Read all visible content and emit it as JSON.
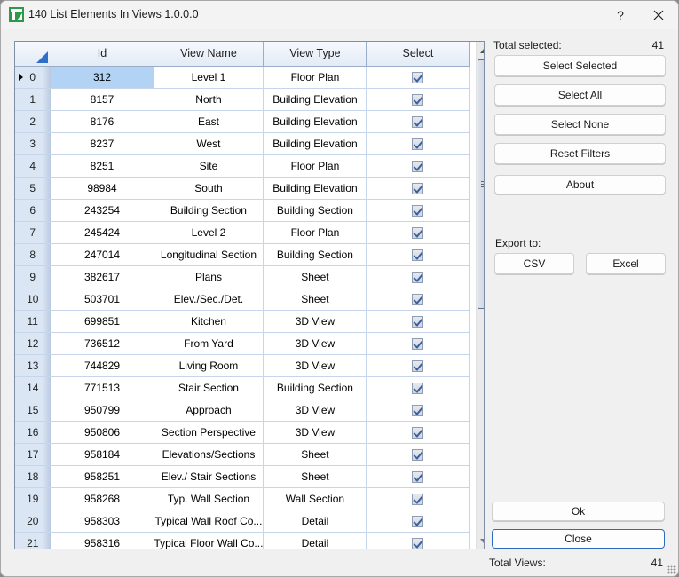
{
  "window": {
    "title": "140 List Elements In Views 1.0.0.0",
    "icon": "app-logo-icon",
    "help_label": "?",
    "close_icon": "close-icon"
  },
  "grid": {
    "columns": [
      "Id",
      "View Name",
      "View Type",
      "Select"
    ],
    "current_row": 0,
    "rows": [
      {
        "index": "0",
        "id": "312",
        "name": "Level 1",
        "type": "Floor Plan",
        "selected": true
      },
      {
        "index": "1",
        "id": "8157",
        "name": "North",
        "type": "Building Elevation",
        "selected": true
      },
      {
        "index": "2",
        "id": "8176",
        "name": "East",
        "type": "Building Elevation",
        "selected": true
      },
      {
        "index": "3",
        "id": "8237",
        "name": "West",
        "type": "Building Elevation",
        "selected": true
      },
      {
        "index": "4",
        "id": "8251",
        "name": "Site",
        "type": "Floor Plan",
        "selected": true
      },
      {
        "index": "5",
        "id": "98984",
        "name": "South",
        "type": "Building Elevation",
        "selected": true
      },
      {
        "index": "6",
        "id": "243254",
        "name": "Building Section",
        "type": "Building Section",
        "selected": true
      },
      {
        "index": "7",
        "id": "245424",
        "name": "Level 2",
        "type": "Floor Plan",
        "selected": true
      },
      {
        "index": "8",
        "id": "247014",
        "name": "Longitudinal Section",
        "type": "Building Section",
        "selected": true
      },
      {
        "index": "9",
        "id": "382617",
        "name": "Plans",
        "type": "Sheet",
        "selected": true
      },
      {
        "index": "10",
        "id": "503701",
        "name": "Elev./Sec./Det.",
        "type": "Sheet",
        "selected": true
      },
      {
        "index": "11",
        "id": "699851",
        "name": "Kitchen",
        "type": "3D View",
        "selected": true
      },
      {
        "index": "12",
        "id": "736512",
        "name": "From Yard",
        "type": "3D View",
        "selected": true
      },
      {
        "index": "13",
        "id": "744829",
        "name": "Living Room",
        "type": "3D View",
        "selected": true
      },
      {
        "index": "14",
        "id": "771513",
        "name": "Stair Section",
        "type": "Building Section",
        "selected": true
      },
      {
        "index": "15",
        "id": "950799",
        "name": "Approach",
        "type": "3D View",
        "selected": true
      },
      {
        "index": "16",
        "id": "950806",
        "name": "Section Perspective",
        "type": "3D View",
        "selected": true
      },
      {
        "index": "17",
        "id": "958184",
        "name": "Elevations/Sections",
        "type": "Sheet",
        "selected": true
      },
      {
        "index": "18",
        "id": "958251",
        "name": "Elev./ Stair Sections",
        "type": "Sheet",
        "selected": true
      },
      {
        "index": "19",
        "id": "958268",
        "name": "Typ. Wall Section",
        "type": "Wall Section",
        "selected": true
      },
      {
        "index": "20",
        "id": "958303",
        "name": "Typical Wall Roof Co...",
        "type": "Detail",
        "selected": true
      },
      {
        "index": "21",
        "id": "958316",
        "name": "Typical Floor Wall Co...",
        "type": "Detail",
        "selected": true
      }
    ]
  },
  "panel": {
    "total_selected_label": "Total selected:",
    "total_selected_value": "41",
    "select_selected": "Select Selected",
    "select_all": "Select All",
    "select_none": "Select None",
    "reset_filters": "Reset Filters",
    "about": "About",
    "export_label": "Export to:",
    "csv": "CSV",
    "excel": "Excel",
    "ok": "Ok",
    "close": "Close",
    "total_views_label": "Total Views:",
    "total_views_value": "41"
  },
  "colors": {
    "selected_cell": "#b3d3f5",
    "header_gradient_bottom": "#e3ebf6",
    "default_button_border": "#2a6cc0",
    "brand_green": "#2e9a49"
  }
}
